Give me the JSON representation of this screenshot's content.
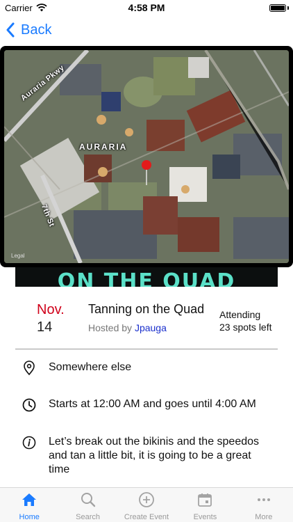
{
  "status_bar": {
    "carrier": "Carrier",
    "time": "4:58 PM"
  },
  "nav": {
    "back_label": "Back"
  },
  "map": {
    "labels": {
      "road_top": "Auraria Pkwy",
      "area": "AURARIA",
      "street": "7th St"
    },
    "legal": "Legal"
  },
  "banner": {
    "text": "ON THE QUAD"
  },
  "event": {
    "month": "Nov.",
    "day": "14",
    "title": "Tanning on the Quad",
    "hosted_prefix": "Hosted by",
    "host": "Jpauga",
    "attending_label": "Attending",
    "spots_left": "23 spots left"
  },
  "details": {
    "location": "Somewhere else",
    "time": "Starts at 12:00 AM and goes until 4:00 AM",
    "description": "Let’s break out the bikinis and the speedos and tan a little bit, it is going to be a great time"
  },
  "tabs": [
    {
      "label": "Home",
      "icon": "home-icon",
      "active": true
    },
    {
      "label": "Search",
      "icon": "search-icon",
      "active": false
    },
    {
      "label": "Create Event",
      "icon": "add-circle-icon",
      "active": false
    },
    {
      "label": "Events",
      "icon": "calendar-icon",
      "active": false
    },
    {
      "label": "More",
      "icon": "more-icon",
      "active": false
    }
  ],
  "colors": {
    "accent": "#1a7bff",
    "month": "#d0021b",
    "host_link": "#1a2fcc",
    "banner_text": "#5be0c8"
  }
}
